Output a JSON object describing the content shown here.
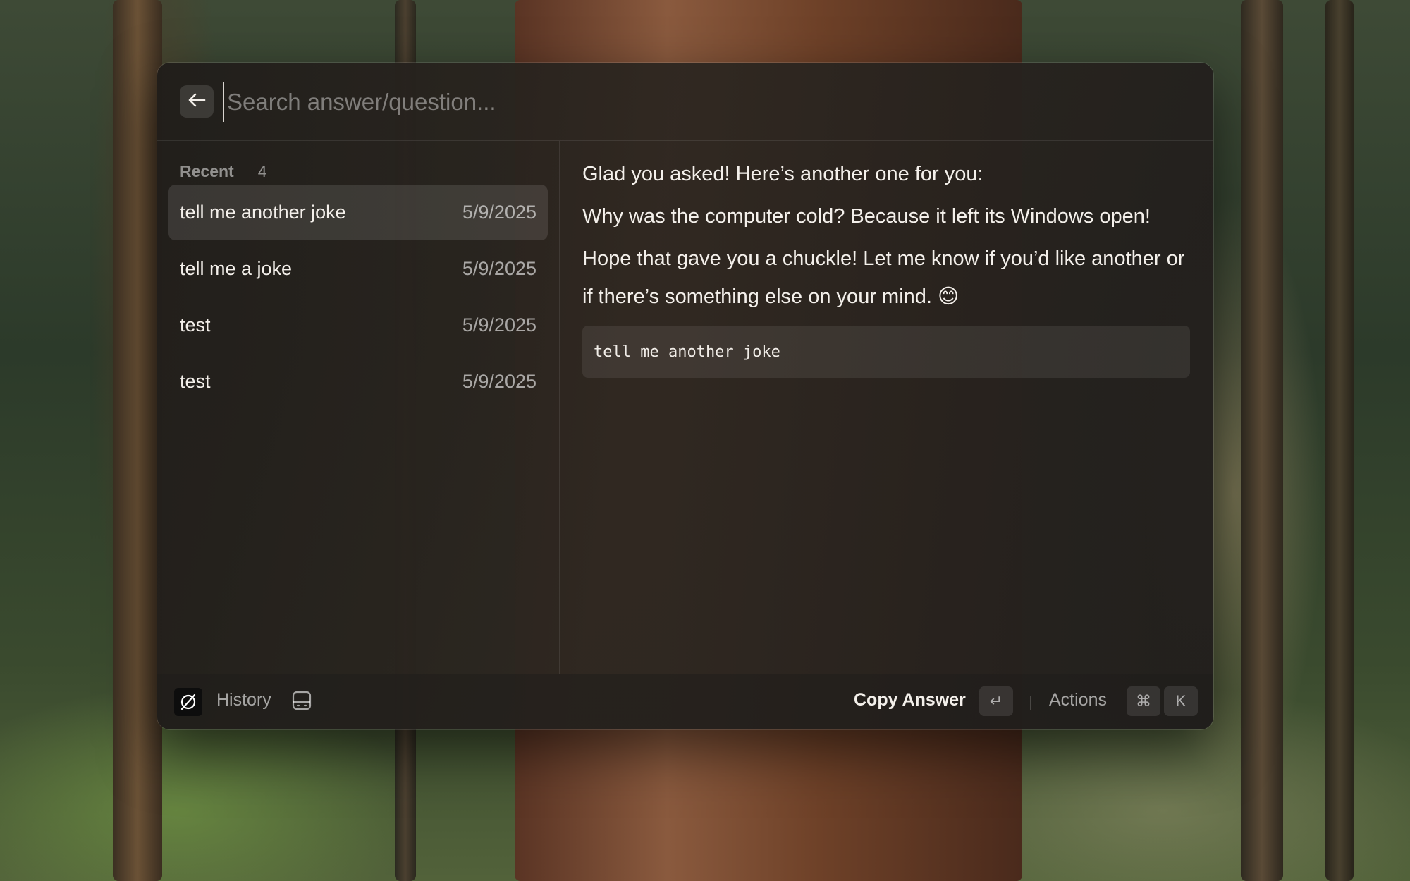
{
  "search": {
    "placeholder": "Search answer/question...",
    "value": ""
  },
  "sidebar": {
    "section_title": "Recent",
    "section_count": "4",
    "items": [
      {
        "label": "tell me another joke",
        "date": "5/9/2025",
        "selected": true
      },
      {
        "label": "tell me a joke",
        "date": "5/9/2025",
        "selected": false
      },
      {
        "label": "test",
        "date": "5/9/2025",
        "selected": false
      },
      {
        "label": "test",
        "date": "5/9/2025",
        "selected": false
      }
    ]
  },
  "detail": {
    "paragraphs": [
      "Glad you asked! Here’s another one for you:",
      "Why was the computer cold? Because it left its Windows open!",
      "Hope that gave you a chuckle! Let me know if you’d like another or if there’s something else on your mind. 😊"
    ],
    "question": "tell me another joke"
  },
  "footer": {
    "title": "History",
    "primary_action": "Copy Answer",
    "primary_shortcut": "↵",
    "actions_label": "Actions",
    "actions_shortcut_modifier": "⌘",
    "actions_shortcut_key": "K"
  },
  "icons": {
    "back": "arrow-left-icon",
    "app": "app-logo-icon",
    "toggle": "sidebar-toggle-icon"
  }
}
